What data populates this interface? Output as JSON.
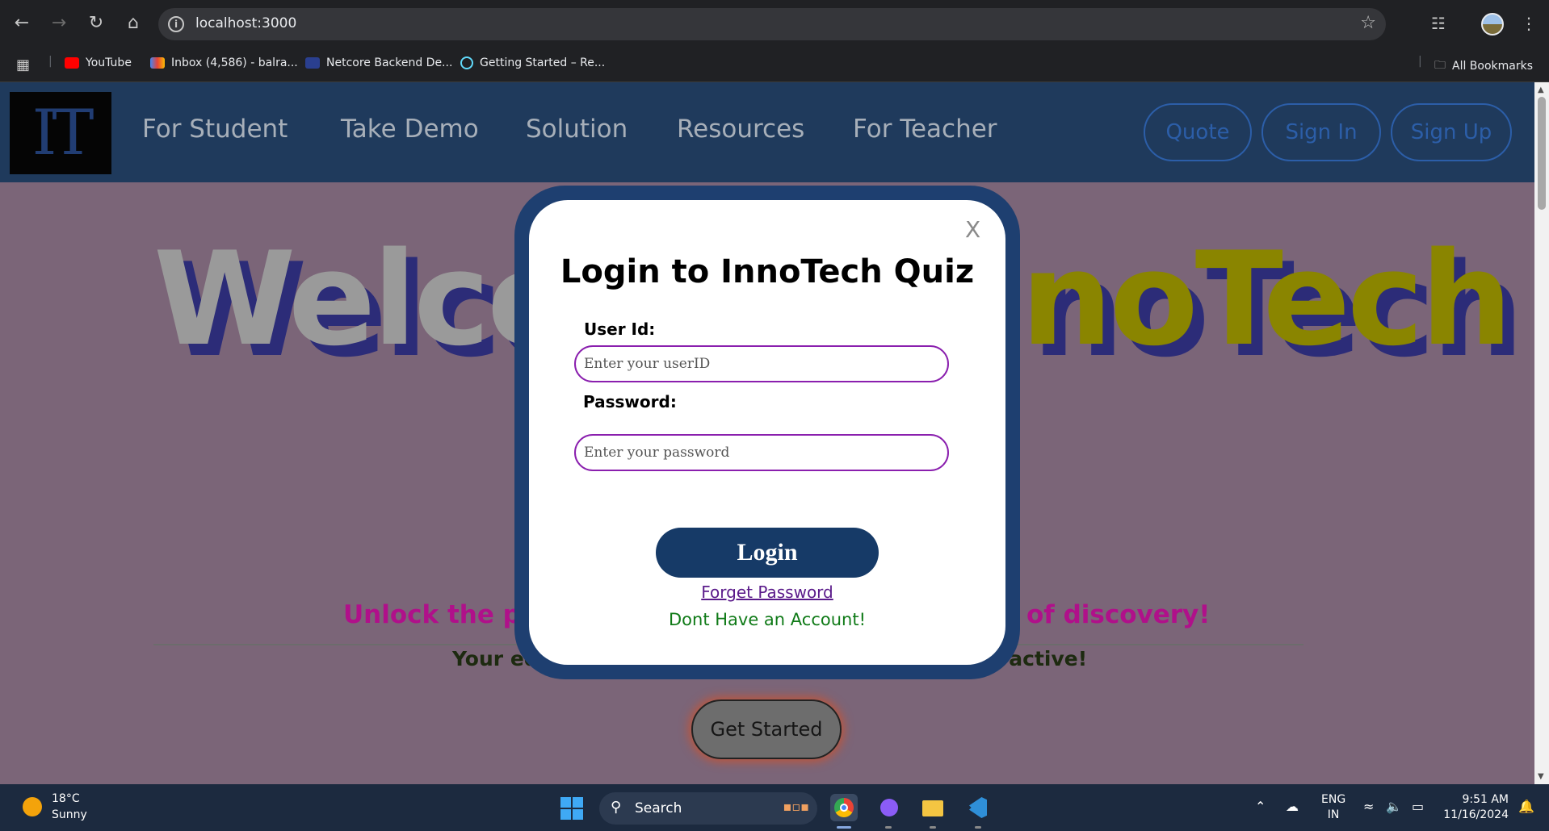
{
  "browser": {
    "url": "localhost:3000",
    "bookmarks": [
      {
        "label": "YouTube",
        "icon": "youtube-icon"
      },
      {
        "label": "Inbox (4,586) - balra...",
        "icon": "gmail-icon"
      },
      {
        "label": "Netcore Backend De...",
        "icon": "netcore-icon"
      },
      {
        "label": "Getting Started – Re...",
        "icon": "react-icon"
      }
    ],
    "all_bookmarks": "All Bookmarks"
  },
  "site": {
    "logo_text": "IT",
    "nav": [
      "For Student",
      "Take Demo",
      "Solution",
      "Resources",
      "For Teacher"
    ],
    "buttons": {
      "quote": "Quote",
      "sign_in": "Sign In",
      "sign_up": "Sign Up"
    },
    "hero": {
      "title_left": "Welco",
      "title_right": "noTech",
      "tagline_left": "Unlock the pow",
      "tagline_right": "y of discovery!",
      "subline_left": "Your edu",
      "subline_right": "eractive!",
      "cta": "Get Started"
    }
  },
  "modal": {
    "close": "X",
    "title": "Login to InnoTech Quiz",
    "user_label": "User Id:",
    "user_placeholder": "Enter your userID",
    "password_label": "Password:",
    "password_placeholder": "Enter your password",
    "login": "Login",
    "forget": "Forget Password",
    "no_account": "Dont Have an Account!"
  },
  "taskbar": {
    "temp": "18°C",
    "condition": "Sunny",
    "search": "Search",
    "lang_1": "ENG",
    "lang_2": "IN",
    "time": "9:51 AM",
    "date": "11/16/2024"
  },
  "colors": {
    "header_bg": "#1f3a5c",
    "page_overlay": "#7b6578",
    "modal_frame": "#1e3f70",
    "login_button": "#163a67",
    "input_border": "#8a1fae"
  }
}
